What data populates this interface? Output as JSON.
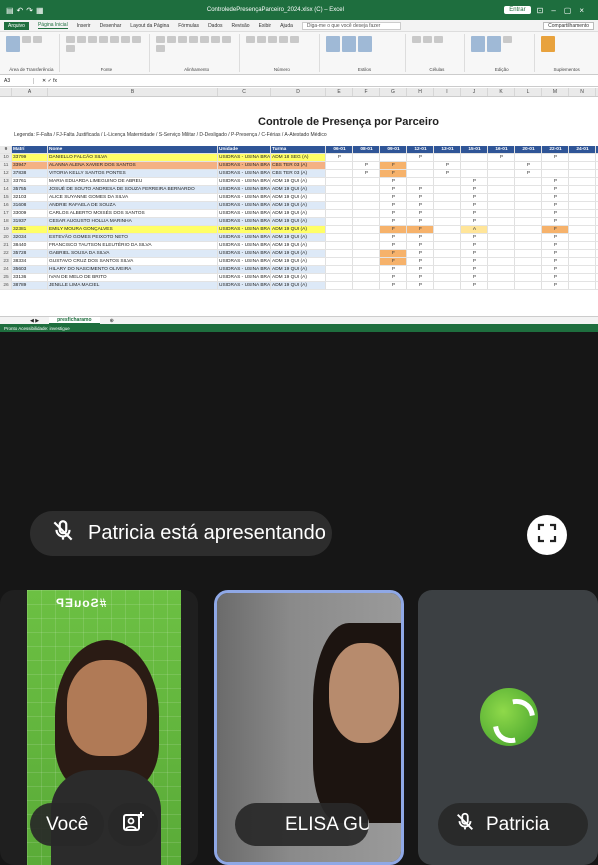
{
  "excel": {
    "file_name": "ControledePresençaParceiro_2024.xlsx (C) – Excel",
    "enter_label": "Entrar",
    "tabs": [
      "Arquivo",
      "Página Inicial",
      "Inserir",
      "Desenhar",
      "Layout da Página",
      "Fórmulas",
      "Dados",
      "Revisão",
      "Exibir",
      "Ajuda"
    ],
    "search_placeholder": "Diga-me o que você deseja fazer",
    "share_label": "Compartilhamento",
    "ribbon_groups": [
      "Área de Transferência",
      "Fonte",
      "Alinhamento",
      "Número",
      "Estilos",
      "Células",
      "Edição",
      "Suplementos"
    ],
    "name_box": "A3",
    "column_letters": [
      "A",
      "B",
      "C",
      "D",
      "E",
      "F",
      "G",
      "H",
      "I",
      "J",
      "K",
      "L",
      "M",
      "N"
    ],
    "sheet_title": "Controle de Presença por Parceiro",
    "legend": "Legenda: F-Falta / FJ-Falta Justificada / L-Licença Maternidade / S-Serviço Militar / D-Desligado / P-Presença / C-Férias / A-Atestado Médico",
    "headers": [
      "Matrí",
      "Nome",
      "Unidade",
      "Turma",
      "06-01",
      "08-01",
      "09-01",
      "12-01",
      "13-01",
      "15-01",
      "16-01",
      "20-01",
      "22-01",
      "24-01"
    ],
    "rows": [
      {
        "n": "10",
        "id": "33799",
        "name": "DANIELLO FALCÃO SILVA",
        "unit": "USIDRAS - USINA BRAS",
        "class": "ADM 18 SEG (A)",
        "d": [
          "P",
          "",
          "",
          "P",
          "",
          "",
          "P",
          "",
          "P",
          ""
        ],
        "hl": "y"
      },
      {
        "n": "11",
        "id": "33947",
        "name": "ALANNA ALENA XAVIER DOS SANTOS",
        "unit": "USIDRAS - USINA BRAS",
        "class": "CBS TER 03 (A)",
        "d": [
          "",
          "P",
          "F",
          "",
          "P",
          "",
          "",
          "P",
          "",
          ""
        ],
        "hl": "o"
      },
      {
        "n": "12",
        "id": "37838",
        "name": "VITORIA KELLY SANTOS PONTES",
        "unit": "USIDRAS - USINA BRAS",
        "class": "CBS TER 03 (A)",
        "d": [
          "",
          "P",
          "F",
          "",
          "P",
          "",
          "",
          "P",
          "",
          ""
        ],
        "hl": "b"
      },
      {
        "n": "13",
        "id": "33761",
        "name": "MARIA EDUARDA LIMEGUINO DE ABREU",
        "unit": "USIDRAS - USINA BRAS",
        "class": "ADM 19 QUI (A)",
        "d": [
          "",
          "",
          "P",
          "",
          "",
          "P",
          "",
          "",
          "P",
          ""
        ],
        "hl": "g"
      },
      {
        "n": "14",
        "id": "35755",
        "name": "JOSUÉ DE SOUTO ANDRESA DE SOUZA FERREIRA BERNARDO",
        "unit": "USIDRAS - USINA BRAS",
        "class": "ADM 19 QUI (A)",
        "d": [
          "",
          "",
          "P",
          "P",
          "",
          "P",
          "",
          "",
          "P",
          ""
        ],
        "hl": "b"
      },
      {
        "n": "15",
        "id": "32103",
        "name": "ALICE SUYANNE GOMES DA SILVA",
        "unit": "USIDRAS - USINA BRAS",
        "class": "ADM 19 QUI (A)",
        "d": [
          "",
          "",
          "P",
          "P",
          "",
          "P",
          "",
          "",
          "P",
          ""
        ],
        "hl": "g"
      },
      {
        "n": "16",
        "id": "31608",
        "name": "ANDRIE RAFAELA DE SOUZA",
        "unit": "USIDRAS - USINA BRAS",
        "class": "ADM 19 QUI (A)",
        "d": [
          "",
          "",
          "P",
          "P",
          "",
          "P",
          "",
          "",
          "P",
          ""
        ],
        "hl": "b"
      },
      {
        "n": "17",
        "id": "33009",
        "name": "CARLOS ALBERTO MOISÉS DOS SANTOS",
        "unit": "USIDRAS - USINA BRAS",
        "class": "ADM 19 QUI (A)",
        "d": [
          "",
          "",
          "P",
          "P",
          "",
          "P",
          "",
          "",
          "P",
          ""
        ],
        "hl": "g"
      },
      {
        "n": "18",
        "id": "31937",
        "name": "CESAR AUGUSTO HOLLIA MARINHA",
        "unit": "USIDRAS - USINA BRAS",
        "class": "ADM 19 QUI (A)",
        "d": [
          "",
          "",
          "P",
          "P",
          "",
          "P",
          "",
          "",
          "P",
          ""
        ],
        "hl": "b"
      },
      {
        "n": "19",
        "id": "32381",
        "name": "EMILY MOURA GONÇALVES",
        "unit": "USIDRAS - USINA BRAS",
        "class": "ADM 19 QUI (A)",
        "d": [
          "",
          "",
          "F",
          "F",
          "",
          "A",
          "",
          "",
          "F",
          ""
        ],
        "hl": "y"
      },
      {
        "n": "20",
        "id": "32034",
        "name": "ESTEVÃO GOMES PEIXOTO NETO",
        "unit": "USIDRAS - USINA BRAS",
        "class": "ADM 19 QUI (A)",
        "d": [
          "",
          "",
          "P",
          "P",
          "",
          "P",
          "",
          "",
          "P",
          ""
        ],
        "hl": "b"
      },
      {
        "n": "21",
        "id": "38440",
        "name": "FRANCISCO TAUTSON ELEUTÉRIO DA SILVA",
        "unit": "USIDRAS - USINA BRAS",
        "class": "ADM 19 QUI (A)",
        "d": [
          "",
          "",
          "P",
          "P",
          "",
          "P",
          "",
          "",
          "P",
          ""
        ],
        "hl": "g"
      },
      {
        "n": "22",
        "id": "35728",
        "name": "GABRIEL SOUSA DA SILVA",
        "unit": "USIDRAS - USINA BRAS",
        "class": "ADM 19 QUI (A)",
        "d": [
          "",
          "",
          "F",
          "P",
          "",
          "P",
          "",
          "",
          "P",
          ""
        ],
        "hl": "b"
      },
      {
        "n": "23",
        "id": "38334",
        "name": "GUSTAVO CRUZ DOS SANTOS SILVA",
        "unit": "USIDRAS - USINA BRAS",
        "class": "ADM 19 QUI (A)",
        "d": [
          "",
          "",
          "F",
          "P",
          "",
          "P",
          "",
          "",
          "P",
          ""
        ],
        "hl": "g"
      },
      {
        "n": "24",
        "id": "35603",
        "name": "HILARY DO NASCIMENTO OLIVEIRA",
        "unit": "USIDRAS - USINA BRAS",
        "class": "ADM 19 QUI (A)",
        "d": [
          "",
          "",
          "P",
          "P",
          "",
          "P",
          "",
          "",
          "P",
          ""
        ],
        "hl": "b"
      },
      {
        "n": "25",
        "id": "33136",
        "name": "IVAN DE MELO DE BRITO",
        "unit": "USIDRAS - USINA BRAS",
        "class": "ADM 19 QUI (A)",
        "d": [
          "",
          "",
          "P",
          "P",
          "",
          "P",
          "",
          "",
          "P",
          ""
        ],
        "hl": "g"
      },
      {
        "n": "26",
        "id": "38789",
        "name": "JENILLE LIMA MACIEL",
        "unit": "USIDRAS - USINA BRAS",
        "class": "ADM 19 QUI (A)",
        "d": [
          "",
          "",
          "P",
          "P",
          "",
          "P",
          "",
          "",
          "P",
          ""
        ],
        "hl": "b"
      }
    ],
    "sheet_tab": "presficharamo",
    "status": "Pronto   Acessibilidade: investigue"
  },
  "meet": {
    "presenting_label": "Patricia está apresentando",
    "you_name": "Você",
    "tile_tag": "#SouEP",
    "elisa_name": "ELISA GU",
    "patricia_name": "Patricia"
  }
}
